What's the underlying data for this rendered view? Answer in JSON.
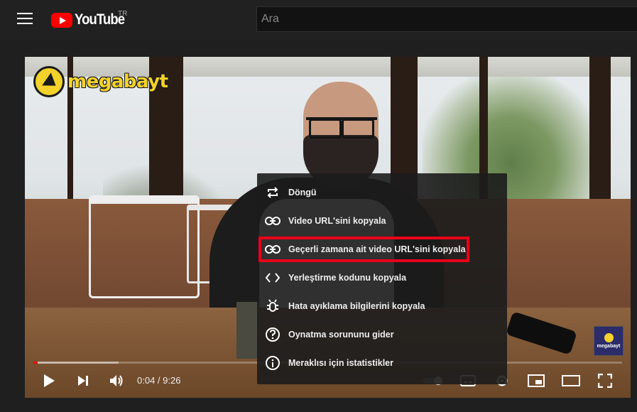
{
  "header": {
    "logo_text": "YouTube",
    "region": "TR",
    "search_placeholder": "Ara"
  },
  "video": {
    "watermark": "megabayt",
    "corner_watermark": "megabayt",
    "time_display": "0:04 / 9:26",
    "progress_fraction": 0.007,
    "buffer_fraction": 0.145
  },
  "context_menu": {
    "items": [
      {
        "label": "Döngü",
        "icon": "loop-icon"
      },
      {
        "label": "Video URL'sini kopyala",
        "icon": "link-icon"
      },
      {
        "label": "Geçerli zamana ait video URL'sini kopyala",
        "icon": "link-icon",
        "highlighted": true
      },
      {
        "label": "Yerleştirme kodunu kopyala",
        "icon": "code-icon"
      },
      {
        "label": "Hata ayıklama bilgilerini kopyala",
        "icon": "bug-icon"
      },
      {
        "label": "Oynatma sorununu gider",
        "icon": "question-icon"
      },
      {
        "label": "Meraklısı için istatistikler",
        "icon": "info-icon"
      }
    ]
  },
  "colors": {
    "accent": "#ff0000",
    "highlight_border": "#e8001a",
    "brand_yellow": "#f3d22a"
  }
}
